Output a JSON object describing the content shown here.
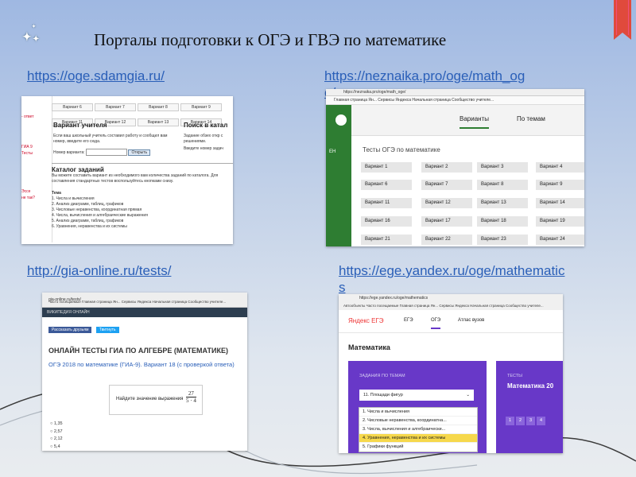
{
  "title": "Порталы подготовки к ОГЭ и ГВЭ по  математике",
  "links": {
    "sdamgia": "https://oge.sdamgia.ru/",
    "neznaika_line1": "https://neznaika.pro/oge/math_og",
    "neznaika_line2": "e/",
    "gia_online": "http://gia-online.ru/tests/",
    "yandex_line1": "https://ege.yandex.ru/oge/mathematic",
    "yandex_line2": "s"
  },
  "shot1": {
    "variants_row1": [
      "Вариант 6",
      "Вариант 7",
      "Вариант 8",
      "Вариант 9"
    ],
    "variants_row2": [
      "Вариант 11",
      "Вариант 12",
      "Вариант 13",
      "Вариант 14"
    ],
    "teacher_title": "Вариант учителя",
    "teacher_text": "Если ваш школьный учитель составил работу и сообщил вам номер, введите его сюда.",
    "variant_number_label": "Номер варианта:",
    "open_button": "Открыть",
    "search_title": "Поиск в катал",
    "search_text": "Задание обзех откр с решениями.",
    "search_text2": "Введите номер задач",
    "catalog_title": "Каталог заданий",
    "catalog_text": "Вы можете составить вариант из необходимого вам количества заданий по каталога. Для составления стандартных тестов воспользуйтесь кнопками снизу.",
    "topic_label": "Тема",
    "topics": [
      "1. Числа и вычисления",
      "2. Анализ диаграмм, таблиц, графиков",
      "3. Числовые неравенства, координатная прямая",
      "4. Числа, вычисления и алгебраические выражения",
      "5. Анализ диаграмм, таблиц, графиков",
      "6. Уравнения, неравенства и их системы"
    ],
    "sidebar": [
      "- ответ",
      "ГИА 9",
      "Тесты",
      "Эссе",
      "не так?"
    ]
  },
  "shot2": {
    "address": "https://neznaika.pro/oge/math_oge/",
    "bookmarks": "Главная страница Ян...   Сервисы Яндекса   Начальная страница   Сообщество учителе...",
    "tab_variants": "Варианты",
    "tab_topics": "По темам",
    "subtitle": "Тесты ОГЭ по математике",
    "buttons": [
      [
        "Вариант 1",
        "Вариант 2",
        "Вариант 3",
        "Вариант 4"
      ],
      [
        "Вариант 6",
        "Вариант 7",
        "Вариант 8",
        "Вариант 9"
      ],
      [
        "Вариант 11",
        "Вариант 12",
        "Вариант 13",
        "Вариант 14"
      ],
      [
        "Вариант 16",
        "Вариант 17",
        "Вариант 18",
        "Вариант 19"
      ],
      [
        "Вариант 21",
        "Вариант 22",
        "Вариант 23",
        "Вариант 24"
      ]
    ],
    "side_text": "ЕН"
  },
  "shot3": {
    "address": "gia-online.ru/tests/",
    "bookmarks": "Часто посещаемые   Главная страница Ян...   Сервисы Яндекса   Начальная страница   Сообщество учителе...",
    "brand": "ВИКИПЕДИЯ ОНЛАЙН",
    "share1": "Рассказать друзьям",
    "share2": "Твитнуть",
    "heading": "ОНЛАЙН ТЕСТЫ ГИА ПО АЛГЕБРЕ (МАТЕМАТИКЕ)",
    "sub": "ОГЭ 2018 по математике (ГИА-9). Вариант 18 (с проверкой ответа)",
    "task": "Найдите значение выражения",
    "frac_num": "27",
    "frac_den": "5 · 4",
    "options": [
      "1,35",
      "2,57",
      "2,12",
      "5,4"
    ]
  },
  "shot4": {
    "address": "https://ege.yandex.ru/oge/mathematics",
    "bookmarks": "Автообъекты   Часто посещаемые   Главная страница Ян...   Сервисы Яндекса   Начальная страница   Сообщество учителе...",
    "logo": "Яндекс ЕГЭ",
    "nav": [
      "ЕГЭ",
      "ОГЭ",
      "Атлас вузов"
    ],
    "heading": "Математика",
    "card1_label": "ЗАДАНИЯ ПО ТЕМАМ",
    "select_value": "11. Площади фигур",
    "card2_label": "ТЕСТЫ",
    "card2_title": "Математика 20",
    "pages": [
      "1",
      "2",
      "3",
      "4"
    ],
    "list": [
      "1. Числа и вычисления",
      "2. Числовые неравенства, координатна...",
      "3. Числа, вычисления и алгебраически...",
      "4. Уравнения, неравенства и их системы",
      "5. Графики функций"
    ]
  },
  "colors": {
    "link": "#2a5fb8",
    "bookmark": "#e04a3c",
    "green": "#2e7d32",
    "purple": "#6838c8"
  }
}
